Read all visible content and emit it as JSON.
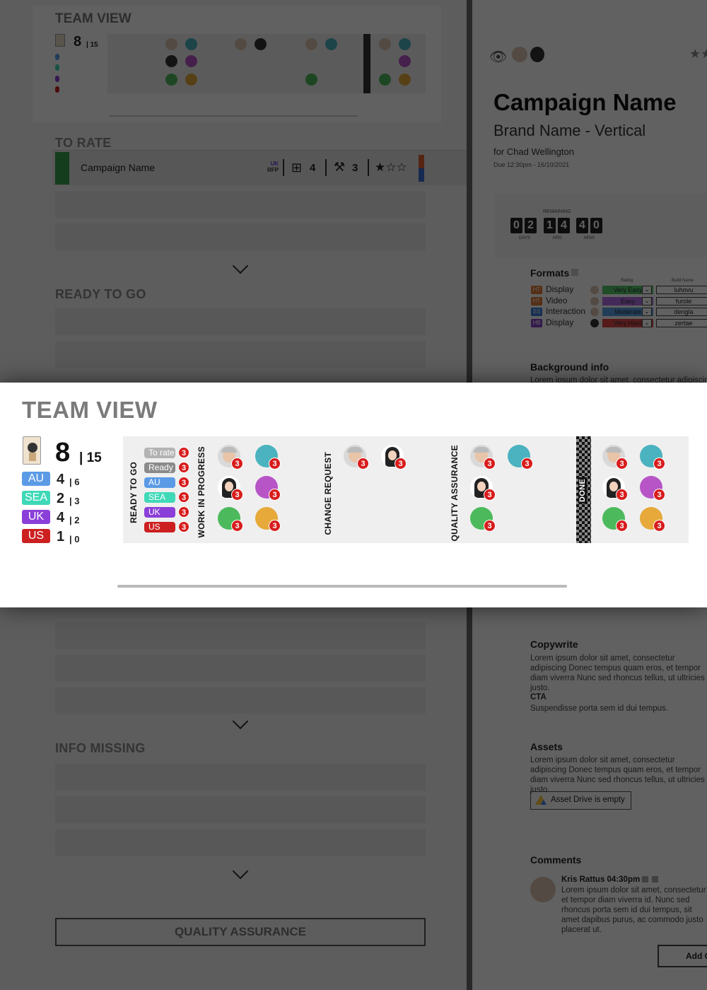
{
  "mini_team_view": {
    "title": "TEAM VIEW",
    "score": "8",
    "total": "| 15"
  },
  "left_panel": {
    "to_rate_title": "TO RATE",
    "ready_to_go_title": "READY TO GO",
    "info_missing_title": "INFO MISSING",
    "quality_assurance_button": "QUALITY ASSURANCE",
    "campaign_row": {
      "name": "Campaign Name",
      "region": "UK",
      "type": "RFP",
      "formats_count": "4",
      "tools_count": "3",
      "stars": "★☆☆"
    }
  },
  "right_panel": {
    "campaign_name": "Campaign Name",
    "brand": "Brand Name - Vertical",
    "for": "for Chad Wellington",
    "due": "Due 12:30pm - 16/10/2021",
    "timer": {
      "label": "REMAINING",
      "days": [
        "0",
        "2"
      ],
      "hrs": [
        "1",
        "4"
      ],
      "mins": [
        "4",
        "0"
      ],
      "days_label": "DAYS",
      "hrs_label": "HRS",
      "mins_label": "MINS"
    },
    "formats_title": "Formats",
    "formats_rating_header": "Rating",
    "formats_build_header": "Build Name",
    "formats": [
      {
        "tag": "HT",
        "tag_color": "#e07b39",
        "name": "Display",
        "rating": "Very Easy",
        "rating_color": "#55c96a",
        "build": "luhovu"
      },
      {
        "tag": "HT",
        "tag_color": "#e07b39",
        "name": "Video",
        "rating": "Easy",
        "rating_color": "#b46ee6",
        "build": "furole"
      },
      {
        "tag": "SS",
        "tag_color": "#3a7fd6",
        "name": "Interaction",
        "rating": "Moderate",
        "rating_color": "#5aa0e8",
        "build": "dengla"
      },
      {
        "tag": "HB",
        "tag_color": "#8a44c9",
        "name": "Display",
        "rating": "Very Hard",
        "rating_color": "#e04848",
        "build": "zertae"
      }
    ],
    "background_title": "Background info",
    "background_text": "Lorem ipsum dolor sit amet, consectetur adipiscing",
    "copywrite_title": "Copywrite",
    "copywrite_text": "Lorem ipsum dolor sit amet, consectetur adipiscing Donec tempus quam eros, et tempor diam viverra Nunc sed rhoncus tellus, ut ultricies justo.",
    "cta_title": "CTA",
    "cta_text": "Suspendisse porta sem id dui tempus.",
    "assets_title": "Assets",
    "assets_text": "Lorem ipsum dolor sit amet, consectetur adipiscing Donec tempus quam eros, et tempor diam viverra Nunc sed rhoncus tellus, ut ultricies justo.",
    "asset_drive_label": "Asset Drive is empty",
    "comments_title": "Comments",
    "comment_author": "Kris Rattus 04:30pm",
    "comment_text": "Lorem ipsum dolor sit amet, consectetur et tempor diam viverra id. Nunc sed rhoncus porta sem id dui tempus, sit amet dapibus purus, ac commodo justo placerat ut.",
    "add_comment_label": "Add C"
  },
  "team_view": {
    "title": "TEAM VIEW",
    "score": "8",
    "score_total": "| 15",
    "regions": [
      {
        "code": "AU",
        "color": "#5b9be6",
        "count": "4",
        "total": "| 6"
      },
      {
        "code": "SEA",
        "color": "#3fd9b8",
        "count": "2",
        "total": "| 3"
      },
      {
        "code": "UK",
        "color": "#8b3fd9",
        "count": "4",
        "total": "| 2"
      },
      {
        "code": "US",
        "color": "#cc2020",
        "count": "1",
        "total": "| 0"
      }
    ],
    "columns": {
      "ready_to_go": "READY TO GO",
      "work_in_progress": "WORK IN PROGRESS",
      "change_request": "CHANGE REQUEST",
      "quality_assurance": "QUALITY ASSURANCE",
      "done": "DONE"
    },
    "ready_tags": [
      {
        "label": "To rate",
        "color": "#b3b3b3",
        "badge": "3"
      },
      {
        "label": "Ready",
        "color": "#8a8a8a",
        "badge": "3"
      },
      {
        "label": "AU",
        "color": "#5b9be6",
        "badge": "3"
      },
      {
        "label": "SEA",
        "color": "#3fd9b8",
        "badge": "3"
      },
      {
        "label": "UK",
        "color": "#8b3fd9",
        "badge": "3"
      },
      {
        "label": "US",
        "color": "#cc2020",
        "badge": "3"
      }
    ],
    "badge_count": "3",
    "colors": {
      "teal": "#4ab3bf",
      "purple": "#b755c7",
      "green": "#4cba5c",
      "orange": "#e6a93a"
    }
  }
}
